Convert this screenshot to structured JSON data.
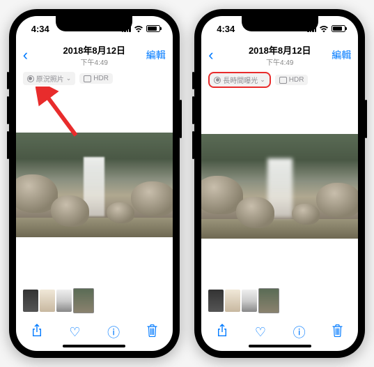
{
  "status": {
    "time": "4:34"
  },
  "nav": {
    "date": "2018年8月12日",
    "time_sub": "下午4:49",
    "edit": "編輯"
  },
  "phone_left": {
    "live_tag_label": "原況照片",
    "hdr_label": "HDR"
  },
  "phone_right": {
    "live_tag_label": "長時間曝光",
    "hdr_label": "HDR"
  },
  "icons": {
    "back": "‹",
    "share": "⬆",
    "heart": "♡",
    "info": "ⓘ",
    "trash": "🗑"
  }
}
